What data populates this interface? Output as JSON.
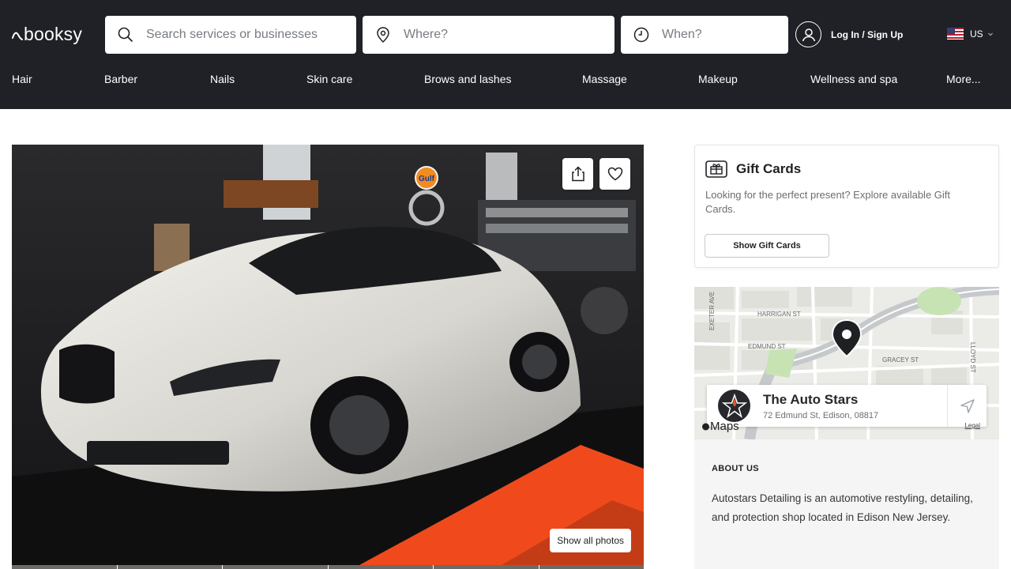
{
  "header": {
    "logo_text": "booksy",
    "search_placeholder": "Search services or businesses",
    "where_placeholder": "Where?",
    "when_placeholder": "When?",
    "login_label": "Log In / Sign Up",
    "country_label": "US"
  },
  "categories": [
    "Hair",
    "Barber",
    "Nails",
    "Skin care",
    "Brows and lashes",
    "Massage",
    "Makeup",
    "Wellness and spa",
    "More..."
  ],
  "gallery": {
    "show_all_label": "Show all photos",
    "photo_sign": "Gulf"
  },
  "gift_cards": {
    "title": "Gift Cards",
    "description": "Looking for the perfect present? Explore available Gift Cards.",
    "button_label": "Show Gift Cards"
  },
  "map": {
    "streets": [
      "HARRIGAN ST",
      "EDMUND ST",
      "GRACEY ST",
      "EXETER AVE",
      "LLOYD ST"
    ],
    "attribution": "Maps",
    "legal_label": "Legal"
  },
  "business": {
    "name": "The Auto Stars",
    "address": "72 Edmund St, Edison, 08817"
  },
  "about": {
    "heading": "ABOUT US",
    "text": "Autostars Detailing is an automotive restyling, detailing, and protection shop located in Edison New Jersey."
  },
  "colors": {
    "header_bg": "#1f2126",
    "floor_accent": "#f04a1c"
  }
}
